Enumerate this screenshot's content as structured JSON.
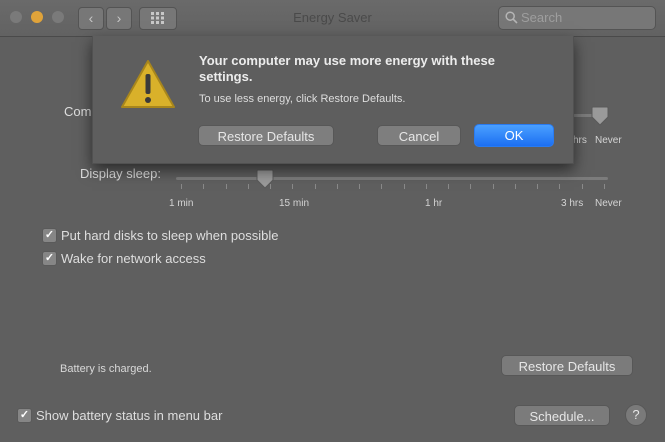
{
  "window": {
    "title": "Energy Saver"
  },
  "toolbar": {
    "back": "‹",
    "forward": "›",
    "search_placeholder": "Search"
  },
  "computer_sleep": {
    "label_visible": "Com",
    "tick_labels": [
      "hrs",
      "Never"
    ],
    "value": "Never"
  },
  "display_sleep": {
    "label": "Display sleep:",
    "tick_labels": [
      "1 min",
      "15 min",
      "1 hr",
      "3 hrs",
      "Never"
    ],
    "value": "15 min"
  },
  "options": {
    "hard_disks": {
      "label": "Put hard disks to sleep when possible",
      "checked": true
    },
    "network": {
      "label": "Wake for network access",
      "checked": true
    },
    "battery_status": {
      "label": "Show battery status in menu bar",
      "checked": true
    }
  },
  "status": {
    "battery": "Battery is charged."
  },
  "buttons": {
    "restore_defaults": "Restore Defaults",
    "schedule": "Schedule...",
    "help": "?"
  },
  "alert": {
    "title": "Your computer may use more energy with these settings.",
    "message": "To use less energy, click Restore Defaults.",
    "restore_defaults": "Restore Defaults",
    "cancel": "Cancel",
    "ok": "OK"
  },
  "colors": {
    "accent": "#1c6ff2",
    "warning": "#d9b12a"
  }
}
